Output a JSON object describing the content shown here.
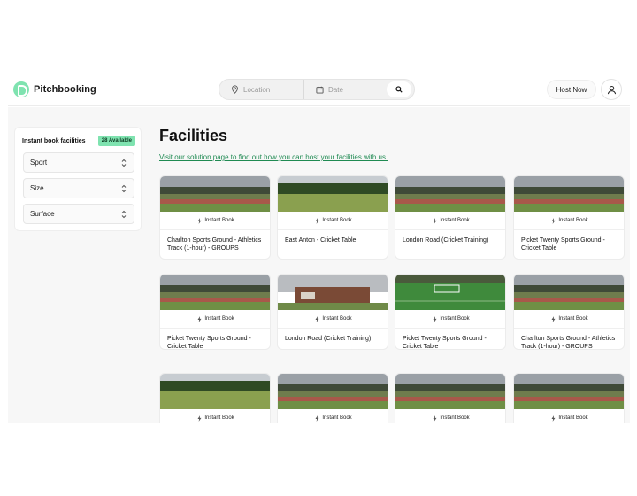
{
  "header": {
    "brand": "Pitchbooking",
    "search": {
      "location_placeholder": "Location",
      "date_placeholder": "Date"
    },
    "host_label": "Host Now"
  },
  "sidebar": {
    "title": "Instant book facilities",
    "badge": "28 Available",
    "filters": [
      "Sport",
      "Size",
      "Surface"
    ]
  },
  "main": {
    "title": "Facilities",
    "link": "Visit our solution page to find out how you can host your facilities with us."
  },
  "instant_book_label": "Instant Book",
  "facilities": [
    {
      "title": "Charlton Sports Ground - Athletics Track (1-hour) - GROUPS",
      "image": "track"
    },
    {
      "title": "East Anton - Cricket Table",
      "image": "field"
    },
    {
      "title": "London Road (Cricket Training)",
      "image": "track"
    },
    {
      "title": "Picket Twenty Sports Ground - Cricket Table",
      "image": "track"
    },
    {
      "title": "Picket Twenty Sports Ground - Cricket Table",
      "image": "track"
    },
    {
      "title": "London Road (Cricket Training)",
      "image": "building"
    },
    {
      "title": "Picket Twenty Sports Ground - Cricket Table",
      "image": "pitch"
    },
    {
      "title": "Charlton Sports Ground - Athletics Track (1-hour) - GROUPS",
      "image": "track"
    },
    {
      "title": "",
      "image": "field"
    },
    {
      "title": "",
      "image": "track"
    },
    {
      "title": "",
      "image": "track"
    },
    {
      "title": "",
      "image": "track"
    }
  ],
  "colors": {
    "accent": "#7fe3b0",
    "link": "#1f8a52"
  }
}
